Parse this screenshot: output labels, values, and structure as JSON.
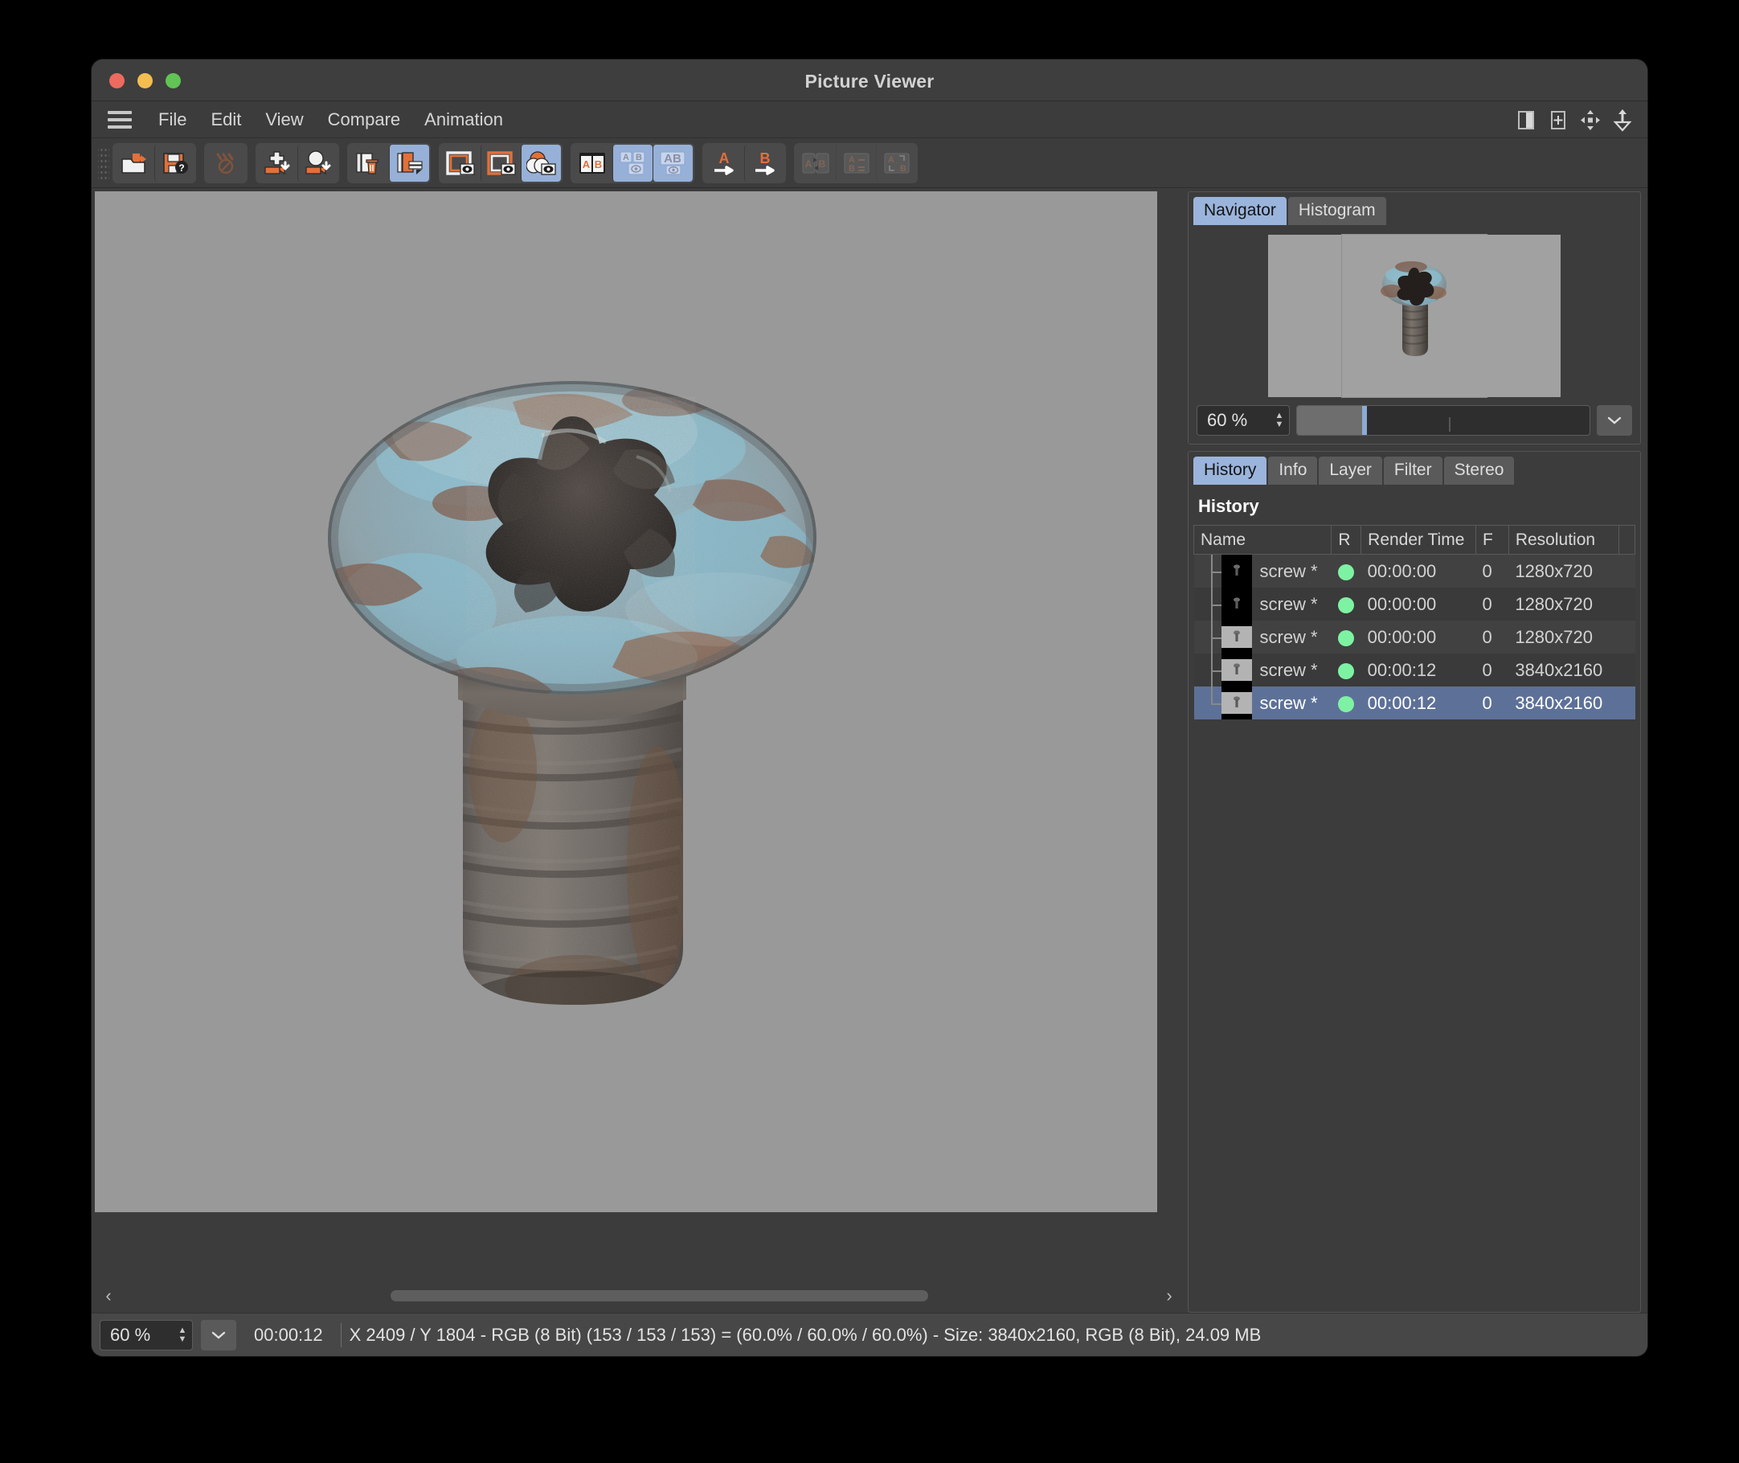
{
  "window": {
    "title": "Picture Viewer",
    "traffic": {
      "close": "close-button",
      "minimize": "minimize-button",
      "zoom": "maximize-button"
    }
  },
  "menubar": {
    "items": [
      "File",
      "Edit",
      "View",
      "Compare",
      "Animation"
    ],
    "right_icons": [
      "split-view-icon",
      "add-frame-icon",
      "move-icon",
      "flip-vertical-icon"
    ]
  },
  "toolbar": {
    "groups": [
      {
        "buttons": [
          {
            "name": "open-file-button",
            "icon": "open-folder-icon",
            "state": "normal"
          },
          {
            "name": "save-as-button",
            "icon": "save-question-icon",
            "state": "normal"
          }
        ]
      },
      {
        "buttons": [
          {
            "name": "stop-render-button",
            "icon": "no-render-icon",
            "state": "disabled"
          }
        ]
      },
      {
        "buttons": [
          {
            "name": "send-to-picture-viewer-button",
            "icon": "move-down-icon",
            "state": "normal"
          },
          {
            "name": "send-object-button",
            "icon": "object-down-icon",
            "state": "normal"
          }
        ]
      },
      {
        "buttons": [
          {
            "name": "clear-history-button",
            "icon": "page-trash-icon",
            "state": "normal"
          },
          {
            "name": "keep-in-history-button",
            "icon": "page-stack-icon",
            "state": "active"
          }
        ]
      },
      {
        "buttons": [
          {
            "name": "view-a-button",
            "icon": "frame-a-icon",
            "state": "normal"
          },
          {
            "name": "view-b-button",
            "icon": "frame-b-icon",
            "state": "normal"
          },
          {
            "name": "view-ab-blend-button",
            "icon": "blend-eye-icon",
            "state": "active"
          }
        ]
      },
      {
        "buttons": [
          {
            "name": "compare-ab-side-button",
            "icon": "ab-split-icon",
            "state": "normal"
          },
          {
            "name": "compare-ab-stack-button",
            "icon": "ab-eye-icon",
            "state": "active"
          },
          {
            "name": "compare-ab-overlay-button",
            "icon": "ab-overlay-eye-icon",
            "state": "active"
          }
        ]
      },
      {
        "buttons": [
          {
            "name": "set-a-button",
            "icon": "a-arrow-icon",
            "state": "normal"
          },
          {
            "name": "set-b-button",
            "icon": "b-arrow-icon",
            "state": "normal"
          }
        ]
      },
      {
        "buttons": [
          {
            "name": "swap-ab-button",
            "icon": "ab-swap-icon",
            "state": "ghost"
          },
          {
            "name": "ab-difference-button",
            "icon": "ab-difference-icon",
            "state": "ghost"
          },
          {
            "name": "ab-sync-button",
            "icon": "ab-sync-icon",
            "state": "ghost"
          }
        ]
      }
    ]
  },
  "canvas": {
    "background_hex": "#999999",
    "image_name": "screw",
    "hscroll": {
      "left_arrow": "‹",
      "right_arrow": "›"
    }
  },
  "navigator": {
    "tabs": [
      {
        "label": "Navigator",
        "active": true
      },
      {
        "label": "Histogram",
        "active": false
      }
    ],
    "zoom_value": "60 %",
    "zoom_percent": 60,
    "dropdown_icon": "chevron-down-icon",
    "spinner_up": "▲",
    "spinner_down": "▼"
  },
  "inspector": {
    "tabs": [
      {
        "label": "History",
        "active": true
      },
      {
        "label": "Info",
        "active": false
      },
      {
        "label": "Layer",
        "active": false
      },
      {
        "label": "Filter",
        "active": false
      },
      {
        "label": "Stereo",
        "active": false
      }
    ],
    "section_title": "History",
    "columns": [
      "Name",
      "R",
      "Render Time",
      "F",
      "Resolution",
      ""
    ],
    "rows": [
      {
        "name": "screw *",
        "r": "render-ok",
        "render_time": "00:00:00",
        "f": "0",
        "resolution": "1280x720",
        "selected": false,
        "thumb": "dark"
      },
      {
        "name": "screw *",
        "r": "render-ok",
        "render_time": "00:00:00",
        "f": "0",
        "resolution": "1280x720",
        "selected": false,
        "thumb": "dark"
      },
      {
        "name": "screw *",
        "r": "render-ok",
        "render_time": "00:00:00",
        "f": "0",
        "resolution": "1280x720",
        "selected": false,
        "thumb": "light"
      },
      {
        "name": "screw *",
        "r": "render-ok",
        "render_time": "00:00:12",
        "f": "0",
        "resolution": "3840x2160",
        "selected": false,
        "thumb": "light"
      },
      {
        "name": "screw *",
        "r": "render-ok",
        "render_time": "00:00:12",
        "f": "0",
        "resolution": "3840x2160",
        "selected": true,
        "thumb": "light"
      }
    ],
    "status_dot_hex": "#7ef2a3",
    "selection_hex": "#5d7198"
  },
  "statusbar": {
    "zoom_value": "60 %",
    "dropdown_icon": "chevron-down-icon",
    "time": "00:00:12",
    "info": "X 2409 / Y 1804 - RGB (8 Bit) (153 / 153 / 153) = (60.0% / 60.0% / 60.0%) - Size: 3840x2160, RGB (8 Bit), 24.09 MB"
  },
  "colors": {
    "window_bg": "#3c3c3c",
    "titlebar": "#3e3e3e",
    "accent_blue": "#9bb4db",
    "accent_orange": "#e2703a",
    "canvas_bg": "#999999"
  }
}
